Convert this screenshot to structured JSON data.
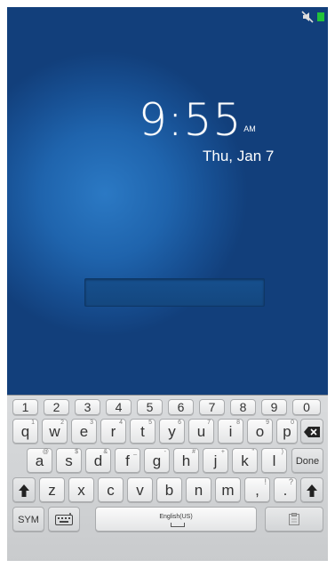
{
  "lockscreen": {
    "time": "9:55",
    "ampm": "AM",
    "date": "Thu, Jan 7",
    "password_placeholder": ""
  },
  "status": {
    "icons": [
      "mute-icon",
      "battery-icon"
    ],
    "battery_color": "#22c33a"
  },
  "keyboard": {
    "numbers": [
      "1",
      "2",
      "3",
      "4",
      "5",
      "6",
      "7",
      "8",
      "9",
      "0"
    ],
    "row1": [
      {
        "k": "q",
        "h": "1"
      },
      {
        "k": "w",
        "h": "2"
      },
      {
        "k": "e",
        "h": "3"
      },
      {
        "k": "r",
        "h": "4"
      },
      {
        "k": "t",
        "h": "5"
      },
      {
        "k": "y",
        "h": "6"
      },
      {
        "k": "u",
        "h": "7"
      },
      {
        "k": "i",
        "h": "8"
      },
      {
        "k": "o",
        "h": "9"
      },
      {
        "k": "p",
        "h": "0"
      }
    ],
    "row2": [
      {
        "k": "a",
        "h": "@"
      },
      {
        "k": "s",
        "h": "$"
      },
      {
        "k": "d",
        "h": "&"
      },
      {
        "k": "f",
        "h": "_"
      },
      {
        "k": "g",
        "h": "-"
      },
      {
        "k": "h",
        "h": "#"
      },
      {
        "k": "j",
        "h": "+"
      },
      {
        "k": "k",
        "h": "\""
      },
      {
        "k": "l",
        "h": ")"
      }
    ],
    "row3": [
      {
        "k": "z",
        "h": ""
      },
      {
        "k": "x",
        "h": ""
      },
      {
        "k": "c",
        "h": ""
      },
      {
        "k": "v",
        "h": ""
      },
      {
        "k": "b",
        "h": ""
      },
      {
        "k": "n",
        "h": ""
      },
      {
        "k": "m",
        "h": ""
      },
      {
        "k": ",",
        "h": ""
      },
      {
        "k": ".",
        "h": ""
      }
    ],
    "done_label": "Done",
    "sym_label": "SYM",
    "space_label": "English(US)",
    "backspace_icon": "backspace-icon",
    "shift_icon": "shift-icon",
    "settings_icon": "keyboard-settings-icon",
    "clipboard_icon": "clipboard-icon"
  }
}
